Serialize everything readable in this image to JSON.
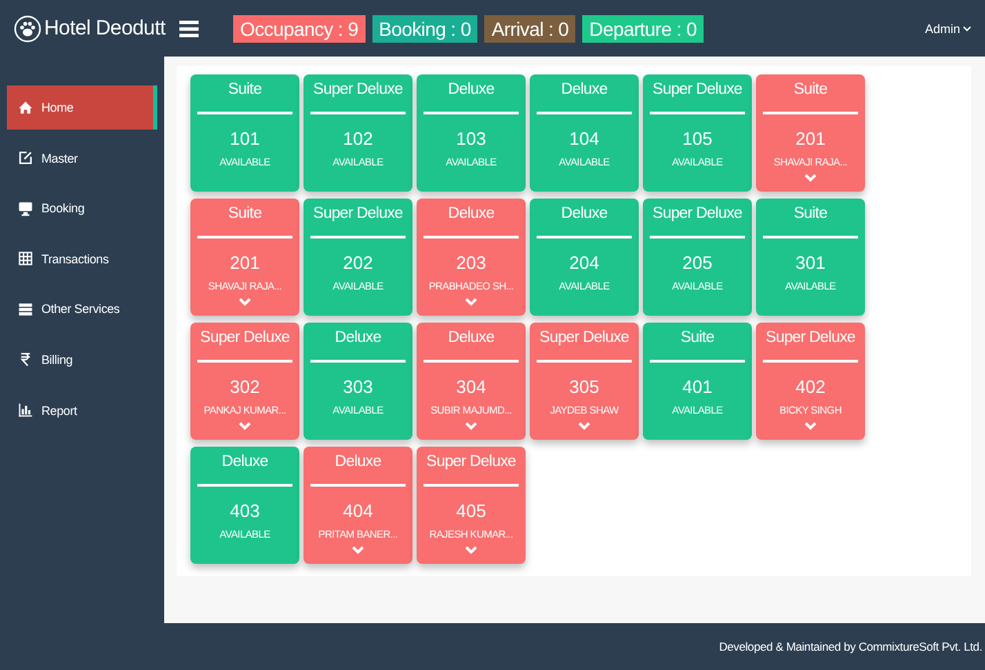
{
  "header": {
    "brand": "Hotel Deodutt",
    "badges": [
      {
        "label": "Occupancy : 9",
        "color": "#f96b6b"
      },
      {
        "label": "Booking : 0",
        "color": "#1aae95"
      },
      {
        "label": "Arrival : 0",
        "color": "#7b5f3e"
      },
      {
        "label": "Departure : 0",
        "color": "#1ec98b"
      }
    ],
    "user": "Admin"
  },
  "sidebar": {
    "items": [
      {
        "label": "Home",
        "selected": true
      },
      {
        "label": "Master",
        "selected": false
      },
      {
        "label": "Booking",
        "selected": false
      },
      {
        "label": "Transactions",
        "selected": false
      },
      {
        "label": "Other Services",
        "selected": false
      },
      {
        "label": "Billing",
        "selected": false
      },
      {
        "label": "Report",
        "selected": false
      }
    ]
  },
  "rooms": [
    {
      "type": "Suite",
      "number": "101",
      "status": "AVAILABLE",
      "occupied": false
    },
    {
      "type": "Super Deluxe",
      "number": "102",
      "status": "AVAILABLE",
      "occupied": false
    },
    {
      "type": "Deluxe",
      "number": "103",
      "status": "AVAILABLE",
      "occupied": false
    },
    {
      "type": "Deluxe",
      "number": "104",
      "status": "AVAILABLE",
      "occupied": false
    },
    {
      "type": "Super Deluxe",
      "number": "105",
      "status": "AVAILABLE",
      "occupied": false
    },
    {
      "type": "Suite",
      "number": "201",
      "status": "SHAVAJI RAJA...",
      "occupied": true
    },
    {
      "type": "Suite",
      "number": "201",
      "status": "SHAVAJI RAJA...",
      "occupied": true
    },
    {
      "type": "Super Deluxe",
      "number": "202",
      "status": "AVAILABLE",
      "occupied": false
    },
    {
      "type": "Deluxe",
      "number": "203",
      "status": "PRABHADEO SH...",
      "occupied": true
    },
    {
      "type": "Deluxe",
      "number": "204",
      "status": "AVAILABLE",
      "occupied": false
    },
    {
      "type": "Super Deluxe",
      "number": "205",
      "status": "AVAILABLE",
      "occupied": false
    },
    {
      "type": "Suite",
      "number": "301",
      "status": "AVAILABLE",
      "occupied": false
    },
    {
      "type": "Super Deluxe",
      "number": "302",
      "status": "PANKAJ KUMAR...",
      "occupied": true
    },
    {
      "type": "Deluxe",
      "number": "303",
      "status": "AVAILABLE",
      "occupied": false
    },
    {
      "type": "Deluxe",
      "number": "304",
      "status": "SUBIR MAJUMD...",
      "occupied": true
    },
    {
      "type": "Super Deluxe",
      "number": "305",
      "status": "JAYDEB SHAW",
      "occupied": true
    },
    {
      "type": "Suite",
      "number": "401",
      "status": "AVAILABLE",
      "occupied": false
    },
    {
      "type": "Super Deluxe",
      "number": "402",
      "status": "BICKY SINGH",
      "occupied": true
    },
    {
      "type": "Deluxe",
      "number": "403",
      "status": "AVAILABLE",
      "occupied": false
    },
    {
      "type": "Deluxe",
      "number": "404",
      "status": "PRITAM BANER...",
      "occupied": true
    },
    {
      "type": "Super Deluxe",
      "number": "405",
      "status": "RAJESH KUMAR...",
      "occupied": true
    }
  ],
  "footer": "Developed & Maintained by CommixtureSoft Pvt. Ltd."
}
